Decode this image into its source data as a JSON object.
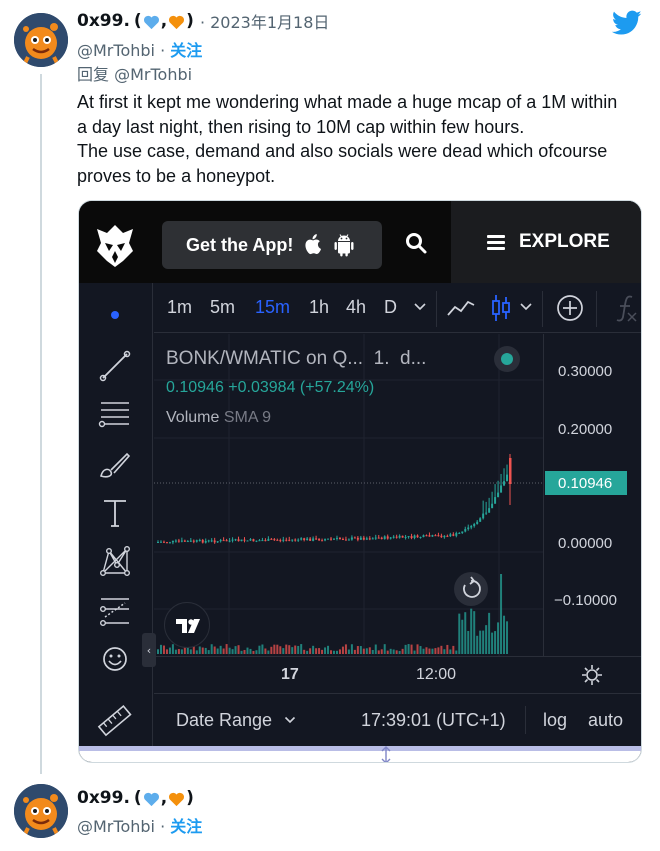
{
  "tweet": {
    "display_name": "0x99.",
    "name_decor_open": "(",
    "name_decor_comma": ",",
    "name_decor_close": ")",
    "date": "· 2023年1月18日",
    "handle": "@MrTohbi",
    "separator": "·",
    "follow_label": "关注",
    "reply_to": "回复 @MrTohbi",
    "text_lines": [
      "At first it kept me wondering what made a huge mcap of a 1M within",
      "a day last night, then rising to  10M cap within few hours.",
      "The use case, demand and also socials were dead which ofcourse",
      "proves to be a honeypot."
    ]
  },
  "media": {
    "get_app_label": "Get the App!",
    "explore_label": "EXPLORE",
    "timeframes": [
      "1m",
      "5m",
      "15m",
      "1h",
      "4h",
      "D"
    ],
    "active_timeframe": "15m",
    "symbol_title": "BONK/WMATIC on Q...",
    "symbol_interval": "1.",
    "symbol_extra": "d...",
    "ohlc_text": "0.10946 +0.03984 (+57.24%)",
    "volume_label": "Volume",
    "volume_indicator": "SMA 9",
    "price_labels": [
      "0.30000",
      "0.20000",
      "0.00000",
      "−0.10000"
    ],
    "last_price": "0.10946",
    "time_labels": [
      "17",
      "12:00"
    ],
    "date_range_label": "Date Range",
    "clock": "17:39:01 (UTC+1)",
    "log_label": "log",
    "auto_label": "auto",
    "colors": {
      "up": "#26a69a",
      "down": "#ef5350",
      "active": "#2962ff",
      "bg": "#131722"
    }
  },
  "tweet2": {
    "display_name": "0x99.",
    "name_decor_open": "(",
    "name_decor_comma": ",",
    "name_decor_close": ")",
    "handle": "@MrTohbi",
    "separator": "·",
    "follow_label": "关注"
  }
}
